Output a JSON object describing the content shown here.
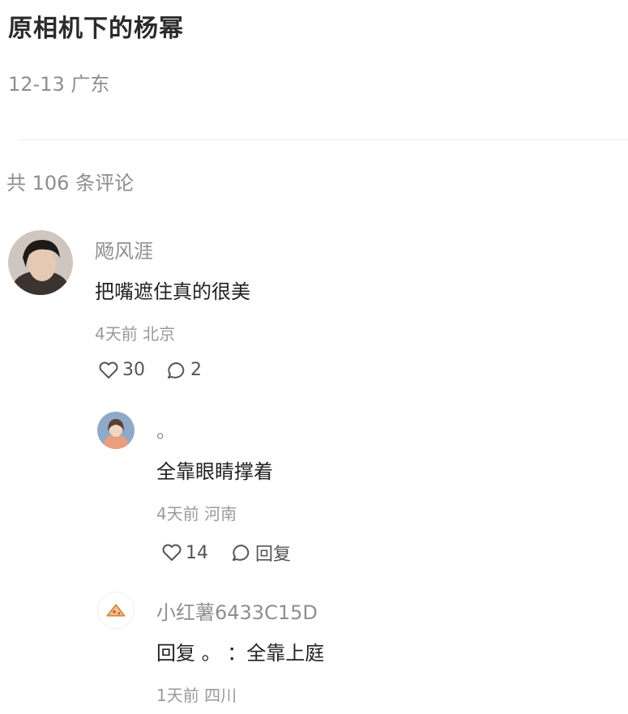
{
  "post": {
    "title": "原相机下的杨幂",
    "meta": "12-13 广东"
  },
  "comment_count_text": "共 106 条评论",
  "comments": [
    {
      "username": "飏风涯",
      "content": "把嘴遮住真的很美",
      "meta": "4天前 北京",
      "like_count": "30",
      "reply_count": "2"
    }
  ],
  "replies": [
    {
      "username": "。",
      "content": "全靠眼睛撑着",
      "meta": "4天前 河南",
      "like_count": "14",
      "reply_label": "回复"
    },
    {
      "username": "小红薯6433C15D",
      "content": "回复 。 ：全靠上庭",
      "meta": "1天前 四川"
    }
  ],
  "icons": {
    "like": "heart-outline-icon",
    "comment": "speech-bubble-icon"
  },
  "colors": {
    "text_primary": "#222222",
    "text_secondary": "#8e8e8e",
    "divider": "#ececec"
  }
}
